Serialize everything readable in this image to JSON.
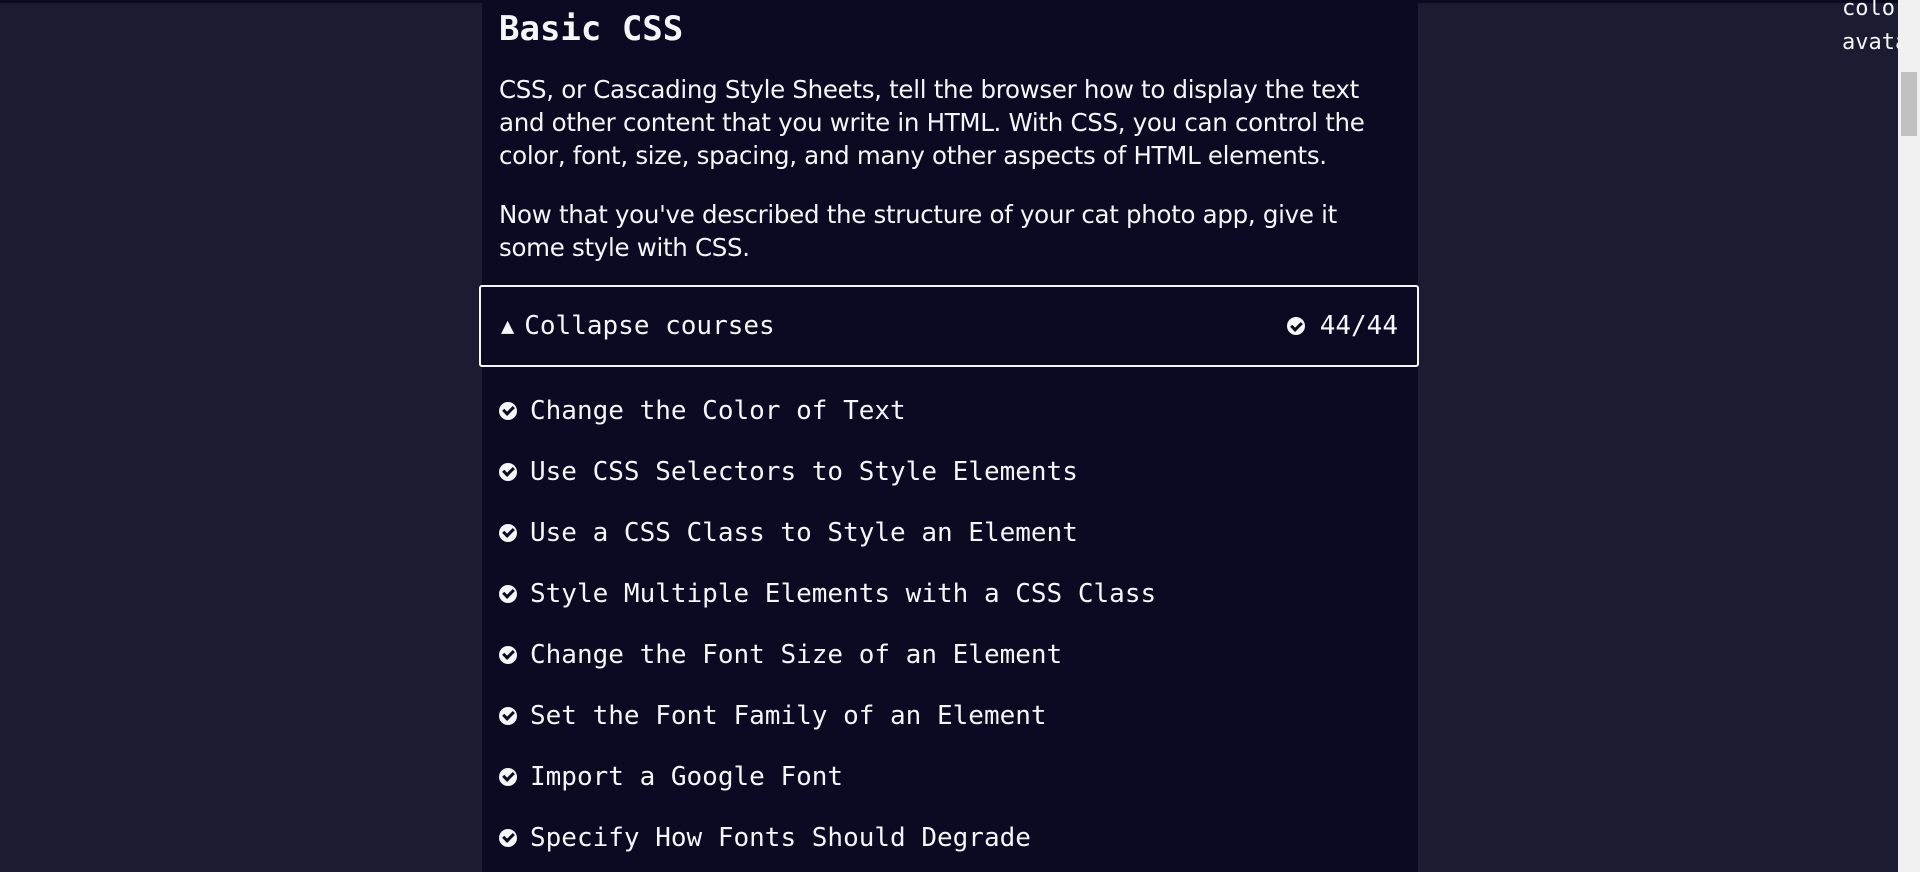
{
  "section": {
    "title": "Basic CSS",
    "paragraphs": [
      "CSS, or Cascading Style Sheets, tell the browser how to display the text and other content that you write in HTML. With CSS, you can control the color, font, size, spacing, and many other aspects of HTML elements.",
      "Now that you've described the structure of your cat photo app, give it some style with CSS."
    ]
  },
  "collapse": {
    "arrow": "▲",
    "label": "Collapse courses",
    "progress": "44/44",
    "icon": "check-circle-icon"
  },
  "courses": [
    "Change the Color of Text",
    "Use CSS Selectors to Style Elements",
    "Use a CSS Class to Style an Element",
    "Style Multiple Elements with a CSS Class",
    "Change the Font Size of an Element",
    "Set the Font Family of an Element",
    "Import a Google Font",
    "Specify How Fonts Should Degrade"
  ],
  "code_snippet": {
    "lines": [
      "colo",
      "avata"
    ]
  },
  "colors": {
    "page_bg": "#1b1b32",
    "panel_bg": "#0a0a23",
    "text": "#f5f6f7"
  }
}
